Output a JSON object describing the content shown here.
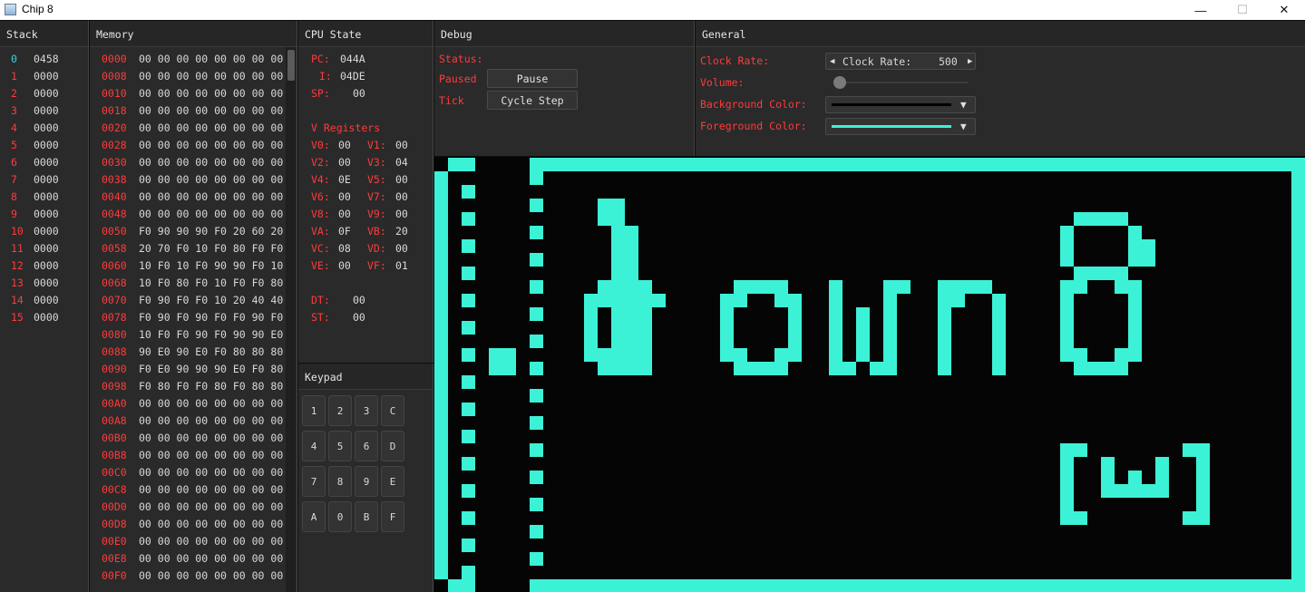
{
  "window": {
    "title": "Chip 8",
    "minimize": "—",
    "maximize": "☐",
    "close": "✕"
  },
  "stack": {
    "title": "Stack",
    "entries": [
      {
        "index": "0",
        "value": "0458"
      },
      {
        "index": "1",
        "value": "0000"
      },
      {
        "index": "2",
        "value": "0000"
      },
      {
        "index": "3",
        "value": "0000"
      },
      {
        "index": "4",
        "value": "0000"
      },
      {
        "index": "5",
        "value": "0000"
      },
      {
        "index": "6",
        "value": "0000"
      },
      {
        "index": "7",
        "value": "0000"
      },
      {
        "index": "8",
        "value": "0000"
      },
      {
        "index": "9",
        "value": "0000"
      },
      {
        "index": "10",
        "value": "0000"
      },
      {
        "index": "11",
        "value": "0000"
      },
      {
        "index": "12",
        "value": "0000"
      },
      {
        "index": "13",
        "value": "0000"
      },
      {
        "index": "14",
        "value": "0000"
      },
      {
        "index": "15",
        "value": "0000"
      }
    ]
  },
  "memory": {
    "title": "Memory",
    "rows": [
      {
        "addr": "0000",
        "bytes": "00 00 00 00 00 00 00 00"
      },
      {
        "addr": "0008",
        "bytes": "00 00 00 00 00 00 00 00"
      },
      {
        "addr": "0010",
        "bytes": "00 00 00 00 00 00 00 00"
      },
      {
        "addr": "0018",
        "bytes": "00 00 00 00 00 00 00 00"
      },
      {
        "addr": "0020",
        "bytes": "00 00 00 00 00 00 00 00"
      },
      {
        "addr": "0028",
        "bytes": "00 00 00 00 00 00 00 00"
      },
      {
        "addr": "0030",
        "bytes": "00 00 00 00 00 00 00 00"
      },
      {
        "addr": "0038",
        "bytes": "00 00 00 00 00 00 00 00"
      },
      {
        "addr": "0040",
        "bytes": "00 00 00 00 00 00 00 00"
      },
      {
        "addr": "0048",
        "bytes": "00 00 00 00 00 00 00 00"
      },
      {
        "addr": "0050",
        "bytes": "F0 90 90 90 F0 20 60 20"
      },
      {
        "addr": "0058",
        "bytes": "20 70 F0 10 F0 80 F0 F0"
      },
      {
        "addr": "0060",
        "bytes": "10 F0 10 F0 90 90 F0 10"
      },
      {
        "addr": "0068",
        "bytes": "10 F0 80 F0 10 F0 F0 80"
      },
      {
        "addr": "0070",
        "bytes": "F0 90 F0 F0 10 20 40 40"
      },
      {
        "addr": "0078",
        "bytes": "F0 90 F0 90 F0 F0 90 F0"
      },
      {
        "addr": "0080",
        "bytes": "10 F0 F0 90 F0 90 90 E0"
      },
      {
        "addr": "0088",
        "bytes": "90 E0 90 E0 F0 80 80 80"
      },
      {
        "addr": "0090",
        "bytes": "F0 E0 90 90 90 E0 F0 80"
      },
      {
        "addr": "0098",
        "bytes": "F0 80 F0 F0 80 F0 80 80"
      },
      {
        "addr": "00A0",
        "bytes": "00 00 00 00 00 00 00 00"
      },
      {
        "addr": "00A8",
        "bytes": "00 00 00 00 00 00 00 00"
      },
      {
        "addr": "00B0",
        "bytes": "00 00 00 00 00 00 00 00"
      },
      {
        "addr": "00B8",
        "bytes": "00 00 00 00 00 00 00 00"
      },
      {
        "addr": "00C0",
        "bytes": "00 00 00 00 00 00 00 00"
      },
      {
        "addr": "00C8",
        "bytes": "00 00 00 00 00 00 00 00"
      },
      {
        "addr": "00D0",
        "bytes": "00 00 00 00 00 00 00 00"
      },
      {
        "addr": "00D8",
        "bytes": "00 00 00 00 00 00 00 00"
      },
      {
        "addr": "00E0",
        "bytes": "00 00 00 00 00 00 00 00"
      },
      {
        "addr": "00E8",
        "bytes": "00 00 00 00 00 00 00 00"
      },
      {
        "addr": "00F0",
        "bytes": "00 00 00 00 00 00 00 00"
      }
    ]
  },
  "cpu": {
    "title": "CPU State",
    "pc_label": "PC:",
    "pc": "044A",
    "i_label": "I:",
    "i": "04DE",
    "sp_label": "SP:",
    "sp": "00",
    "vregs_title": "V Registers",
    "vregs": [
      {
        "name": "V0:",
        "value": "00"
      },
      {
        "name": "V1:",
        "value": "00"
      },
      {
        "name": "V2:",
        "value": "00"
      },
      {
        "name": "V3:",
        "value": "04"
      },
      {
        "name": "V4:",
        "value": "0E"
      },
      {
        "name": "V5:",
        "value": "00"
      },
      {
        "name": "V6:",
        "value": "00"
      },
      {
        "name": "V7:",
        "value": "00"
      },
      {
        "name": "V8:",
        "value": "00"
      },
      {
        "name": "V9:",
        "value": "00"
      },
      {
        "name": "VA:",
        "value": "0F"
      },
      {
        "name": "VB:",
        "value": "20"
      },
      {
        "name": "VC:",
        "value": "08"
      },
      {
        "name": "VD:",
        "value": "00"
      },
      {
        "name": "VE:",
        "value": "00"
      },
      {
        "name": "VF:",
        "value": "01"
      }
    ],
    "dt_label": "DT:",
    "dt": "00",
    "st_label": "ST:",
    "st": "00"
  },
  "keypad": {
    "title": "Keypad",
    "keys": [
      "1",
      "2",
      "3",
      "C",
      "4",
      "5",
      "6",
      "D",
      "7",
      "8",
      "9",
      "E",
      "A",
      "0",
      "B",
      "F"
    ]
  },
  "debug": {
    "title": "Debug",
    "status_label": "Status:",
    "paused_label": "Paused",
    "pause_button": "Pause",
    "tick_label": "Tick",
    "cycle_step_button": "Cycle Step"
  },
  "general": {
    "title": "General",
    "clock_rate_label": "Clock Rate:",
    "clock_rate_inner_label": "Clock Rate:",
    "clock_rate_value": "500",
    "volume_label": "Volume:",
    "volume_level": 0.05,
    "background_label": "Background Color:",
    "foreground_label": "Foreground Color:",
    "background_color": "#000000",
    "foreground_color": "#3cf2d6"
  },
  "display": {
    "pixel_color": "#3cf2d6",
    "background_color": "#050505"
  }
}
